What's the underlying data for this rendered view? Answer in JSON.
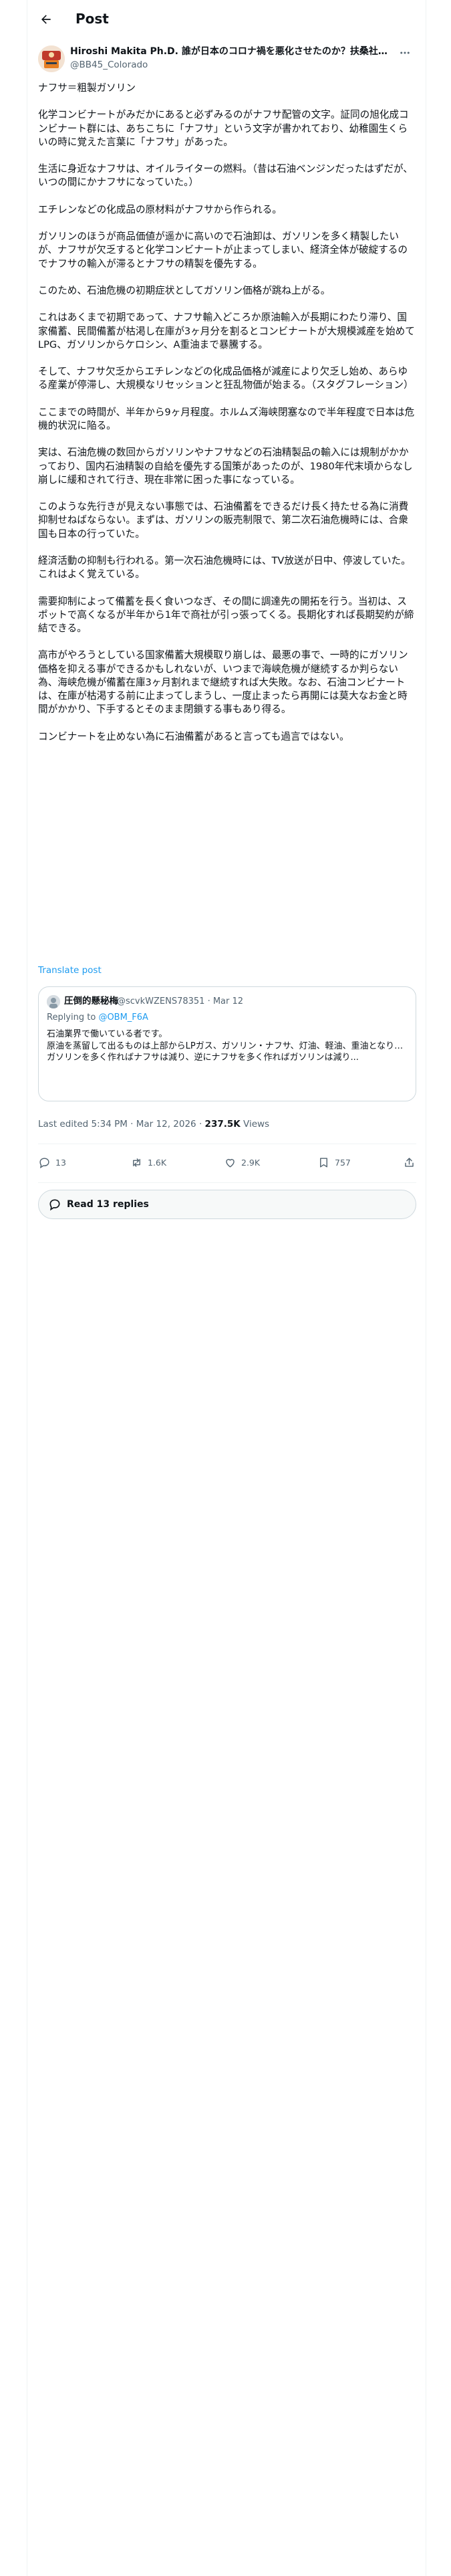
{
  "header": {
    "title": "Post"
  },
  "author": {
    "name": "Hiroshi Makita Ph.D. 誰が日本のコロナ禍を悪化させたのか？扶桑社8...",
    "handle": "@BB45_Colorado"
  },
  "post": {
    "paragraphs": [
      "ナフサ＝粗製ガソリン",
      "化学コンビナートがみだかにあると必ずみるのがナフサ配管の文字。証同の旭化成コンビナート群には、あちこちに「ナフサ」という文字が書かれており、幼稚園生くらいの時に覚えた言葉に「ナフサ」があった。",
      "生活に身近なナフサは、オイルライターの燃料。（昔は石油ベンジンだったはずだが、いつの間にかナフサになっていた。）",
      "エチレンなどの化成品の原材料がナフサから作られる。",
      "ガソリンのほうが商品価値が遥かに高いので石油卸は、ガソリンを多く精製したいが、ナフサが欠乏すると化学コンビナートが止まってしまい、経済全体が破綻するのでナフサの輸入が滞るとナフサの精製を優先する。",
      "このため、石油危機の初期症状としてガソリン価格が跳ね上がる。",
      "これはあくまで初期であって、ナフサ輸入どころか原油輸入が長期にわたり滞り、国家備蓄、民間備蓄が枯渇し在庫が3ヶ月分を割るとコンビナートが大規模減産を始めてLPG、ガソリンからケロシン、A重油まで暴騰する。",
      "そして、ナフサ欠乏からエチレンなどの化成品価格が減産により欠乏し始め、あらゆる産業が停滞し、大規模なリセッションと狂乱物価が始まる。（スタグフレーション）",
      "ここまでの時間が、半年から9ヶ月程度。ホルムズ海峡閉塞なので半年程度で日本は危機的状況に陥る。",
      "実は、石油危機の数回からガソリンやナフサなどの石油精製品の輸入には規制がかかっており、国内石油精製の自給を優先する国策があったのが、1980年代末頃からなし崩しに緩和されて行き、現在非常に困った事になっている。",
      "このような先行きが見えない事態では、石油備蓄をできるだけ長く持たせる為に消費抑制せねばならない。まずは、ガソリンの販売制限で、第二次石油危機時には、合衆国も日本の行っていた。",
      "経済活動の抑制も行われる。第一次石油危機時には、TV放送が日中、停波していた。これはよく覚えている。",
      "需要抑制によって備蓄を長く食いつなぎ、その間に調達先の開拓を行う。当初は、スポットで高くなるが半年から1年で商社が引っ張ってくる。長期化すれば長期契約が締結できる。",
      "高市がやろうとしている国家備蓄大規模取り崩しは、最悪の事で、一時的にガソリン価格を抑える事ができるかもしれないが、いつまで海峡危機が継続するか判らない為、海峡危機が備蓄在庫3ヶ月割れまで継続すれば大失敗。なお、石油コンビナートは、在庫が枯渇する前に止まってしまうし、一度止まったら再開には莫大なお金と時間がかかり、下手するとそのまま閉鎖する事もあり得る。",
      "コンビナートを止めない為に石油備蓄があると言っても過言ではない。"
    ],
    "translate_label": "Translate post",
    "timestamp": "Last edited 5:34 PM · Mar 12, 2026",
    "views_count": "237.5K",
    "views_label": "Views"
  },
  "quote": {
    "name": "圧倒的懸秘梅",
    "handle_date": "@scvkWZENS78351 · Mar 12",
    "replying_prefix": "Replying to",
    "replying_handle": "@OBM_F6A",
    "lines": [
      "石油業界で働いている者です。",
      "原油を蒸留して出るものは上部からLPガス、ガソリン・ナフサ、灯油、軽油、重油となります。",
      "ガソリンを多く作ればナフサは減り、逆にナフサを多く作ればガソリンは減り..."
    ]
  },
  "actions": {
    "replies": "13",
    "reposts": "1.6K",
    "likes": "2.9K",
    "bookmarks": "757"
  },
  "read_replies": {
    "label": "Read 13 replies"
  },
  "colors": {
    "accent": "#1d9bf0",
    "text": "#0f1419",
    "muted": "#536471",
    "border": "#cfd9de"
  }
}
